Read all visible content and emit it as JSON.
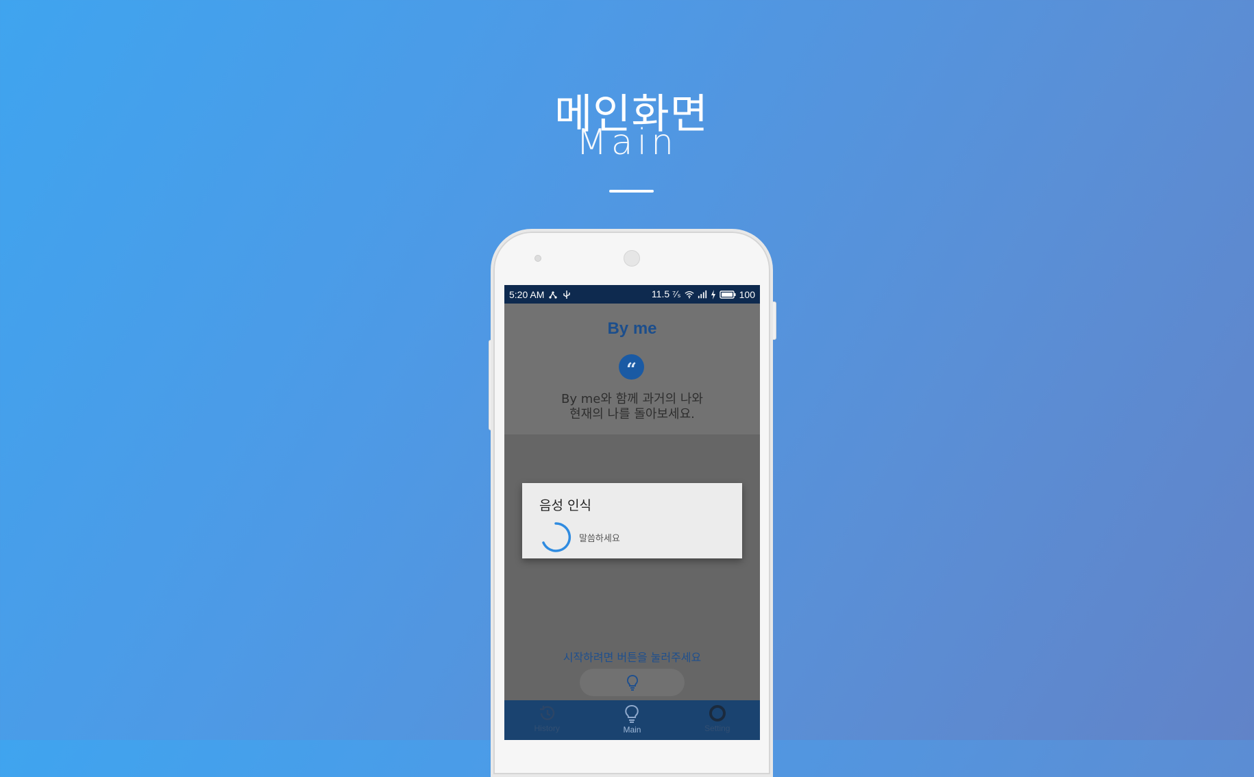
{
  "hero": {
    "title_ko": "메인화면",
    "title_en": "Main"
  },
  "statusbar": {
    "time": "5:20 AM",
    "data_rate": "11.5 ⁷⁄ₛ",
    "battery": "100"
  },
  "app": {
    "title": "By me",
    "intro_line1": "By me와 함께 과거의 나와",
    "intro_line2": "현재의 나를 돌아보세요.",
    "start_hint": "시작하려면 버튼을 눌러주세요"
  },
  "dialog": {
    "title": "음성 인식",
    "message": "말씀하세요"
  },
  "nav": {
    "history": "History",
    "main": "Main",
    "setting": "Setting"
  },
  "colors": {
    "accent": "#1a5aa4",
    "statusbar": "#0e2a4f",
    "nav_bar": "#1a4370",
    "spinner": "#2f8be0"
  }
}
